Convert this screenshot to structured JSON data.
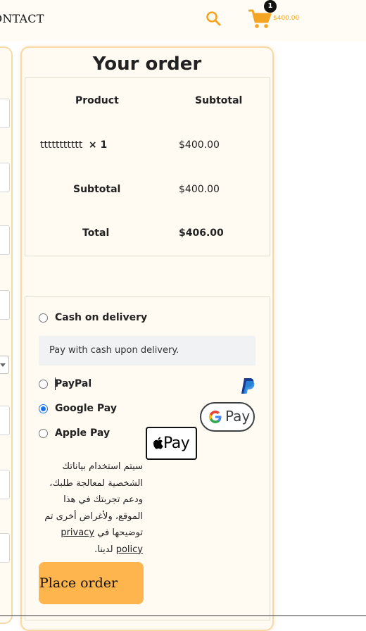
{
  "header": {
    "nav_contact": "ONTACT",
    "cart_count": "1",
    "cart_total": "$400.00",
    "accent_color": "#f5a524"
  },
  "order": {
    "title": "Your order",
    "columns": [
      "Product",
      "Subtotal"
    ],
    "item_name": "ttttttttttt",
    "item_qty": "× 1",
    "item_price": "$400.00",
    "subtotal_label": "Subtotal",
    "subtotal_value": "$400.00",
    "total_label": "Total",
    "total_value": "$406.00"
  },
  "payment": {
    "methods": [
      {
        "label": "Cash on delivery",
        "selected": false
      },
      {
        "label": "PayPal",
        "selected": false
      },
      {
        "label": "Google Pay",
        "selected": true
      },
      {
        "label": "Apple Pay",
        "selected": false
      }
    ],
    "cod_description": "Pay with cash upon delivery.",
    "gpay_label": "Pay",
    "applepay_label": "Pay",
    "privacy_text": "سيتم استخدام بياناتك الشخصية لمعالجة طلبك، ودعم تجربتك في هذا الموقع، ولأغراض أخرى تم توضيحها في",
    "privacy_link": "privacy policy",
    "privacy_suffix": "لدينا.",
    "place_order_label": "Place order"
  }
}
